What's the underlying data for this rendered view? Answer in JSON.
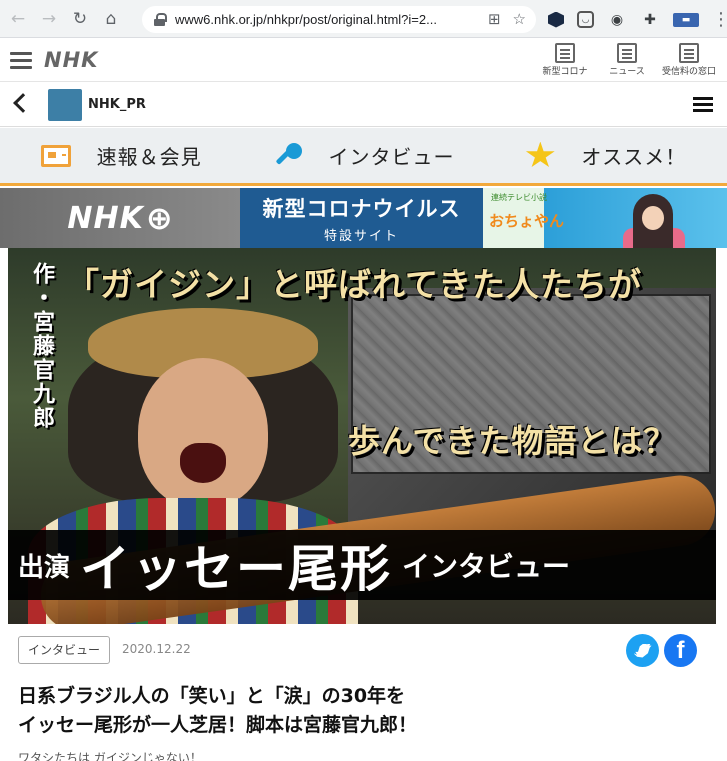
{
  "browser": {
    "url": "www6.nhk.or.jp/nhkpr/post/original.html?i=2..."
  },
  "nhk_header": {
    "logo": "NHK",
    "tools": [
      {
        "label": "新型コロナ",
        "icon": "news-icon"
      },
      {
        "label": "ニュース",
        "icon": "news-icon"
      },
      {
        "label": "受信料の窓口",
        "icon": "desk-icon"
      }
    ]
  },
  "pr_bar": {
    "name": "NHK_PR"
  },
  "categories": [
    {
      "label": "速報＆会見",
      "icon": "news-icon"
    },
    {
      "label": "インタビュー",
      "icon": "microphone-icon"
    },
    {
      "label": "オススメ！",
      "icon": "star-icon"
    }
  ],
  "banners": {
    "nhk_plus": "NHK",
    "corona_line1": "新型コロナウイルス",
    "corona_line2": "特設サイト",
    "drama_title": "おちょやん",
    "drama_sub": "連続テレビ小説"
  },
  "hero": {
    "credit": "作・宮藤官九郎",
    "line1": "「ガイジン」と呼ばれてきた人たちが",
    "line2": "歩んできた物語とは？",
    "appear": "出演",
    "name": "イッセー尾形",
    "interview": "インタビュー"
  },
  "article": {
    "tag": "インタビュー",
    "date": "2020.12.22",
    "title_line1": "日系ブラジル人の「笑い」と「涙」の30年を",
    "title_line2": "イッセー尾形が一人芝居！脚本は宮藤官九郎！",
    "lead": "ワタシたちは ガイジンじゃない！"
  }
}
